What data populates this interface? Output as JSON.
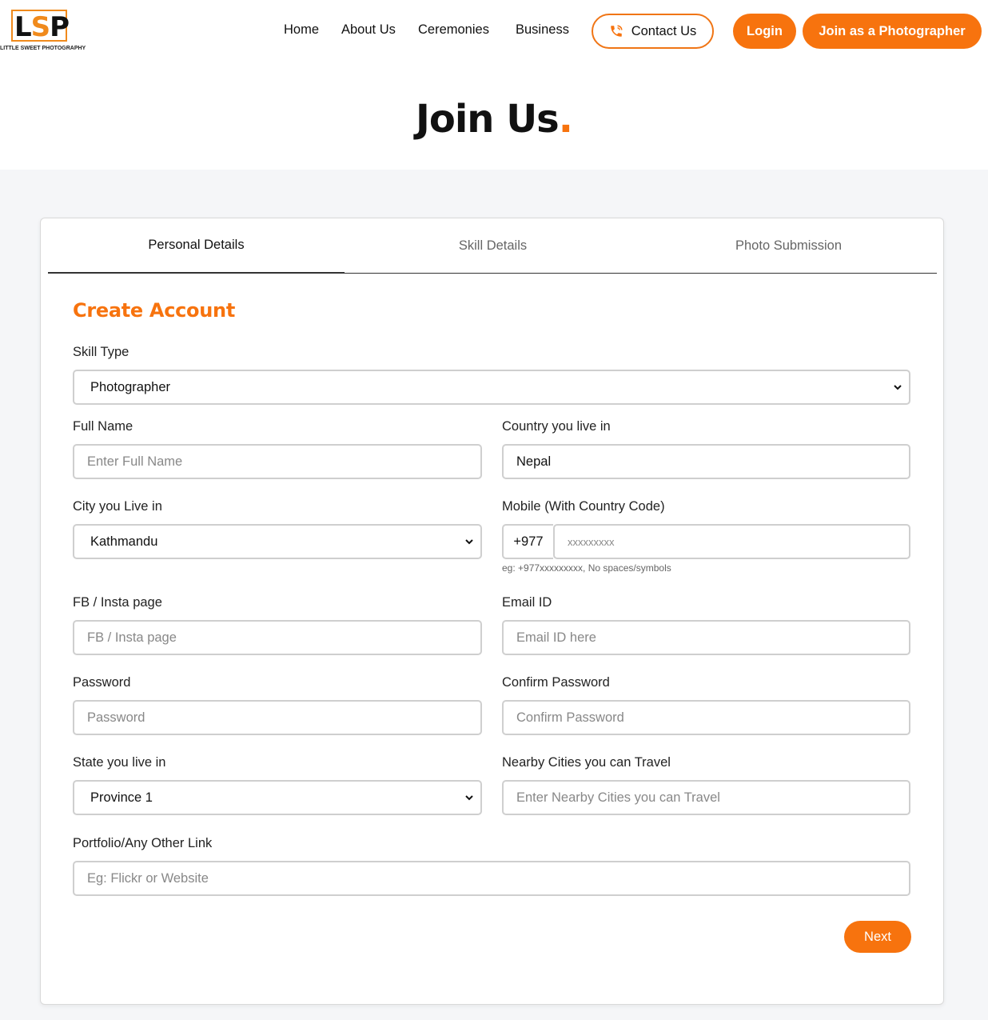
{
  "header": {
    "logo_text": "LSP",
    "logo_tagline": "LITTLE SWEET PHOTOGRAPHY",
    "nav": [
      "Home",
      "About Us",
      "Ceremonies",
      "Business"
    ],
    "contact_label": "Contact Us",
    "login_label": "Login",
    "join_label": "Join as a Photographer"
  },
  "hero": {
    "title": "Join Us",
    "title_dot": "."
  },
  "tabs": [
    "Personal Details",
    "Skill Details",
    "Photo Submission"
  ],
  "form": {
    "title": "Create Account",
    "skill_type": {
      "label": "Skill Type",
      "value": "Photographer"
    },
    "full_name": {
      "label": "Full Name",
      "placeholder": "Enter Full Name"
    },
    "country": {
      "label": "Country you live in",
      "value": "Nepal"
    },
    "city": {
      "label": "City you Live in",
      "value": "Kathmandu"
    },
    "mobile": {
      "label": "Mobile (With Country Code)",
      "code": "+977",
      "placeholder": "xxxxxxxxx",
      "hint": "eg: +977xxxxxxxxx, No spaces/symbols"
    },
    "social": {
      "label": "FB / Insta page",
      "placeholder": "FB / Insta page"
    },
    "email": {
      "label": "Email ID",
      "placeholder": "Email ID here"
    },
    "password": {
      "label": "Password",
      "placeholder": "Password"
    },
    "confirm_password": {
      "label": "Confirm Password",
      "placeholder": "Confirm Password"
    },
    "state": {
      "label": "State you live in",
      "value": "Province 1"
    },
    "nearby": {
      "label": "Nearby Cities you can Travel",
      "placeholder": "Enter Nearby Cities you can Travel"
    },
    "portfolio": {
      "label": "Portfolio/Any Other Link",
      "placeholder": "Eg: Flickr or Website"
    },
    "next_label": "Next"
  },
  "colors": {
    "accent": "#f7730e",
    "border": "#cfcfcf"
  },
  "icons": {
    "contact": "phone-icon",
    "select": "chevron-down-icon"
  }
}
